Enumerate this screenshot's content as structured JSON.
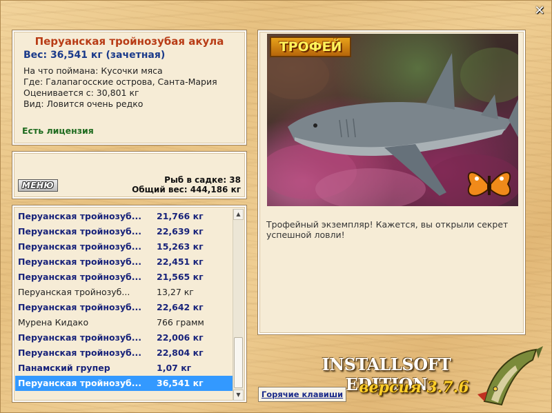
{
  "window": {
    "close_glyph": "✕"
  },
  "fish_info": {
    "title": "Перуанская тройнозубая акула",
    "weight": "Вес: 36,541 кг (зачетная)",
    "details": [
      "На что поймана: Кусочки мяса",
      "Где: Галапагосские острова, Санта-Мария",
      "Оценивается с: 30,801 кг",
      "Вид: Ловится очень редко"
    ],
    "license": "Есть лицензия"
  },
  "stats": {
    "menu_label": "МЕНЮ",
    "fish_in_keepnet": "Рыб в садке: 38",
    "total_weight": "Общий вес: 444,186 кг"
  },
  "catch_list": [
    {
      "name": "Перуанская тройнозуб...",
      "weight": "21,766 кг",
      "style": "bold"
    },
    {
      "name": "Перуанская тройнозуб...",
      "weight": "22,639 кг",
      "style": "bold"
    },
    {
      "name": "Перуанская тройнозуб...",
      "weight": "15,263 кг",
      "style": "bold"
    },
    {
      "name": "Перуанская тройнозуб...",
      "weight": "22,451 кг",
      "style": "bold"
    },
    {
      "name": "Перуанская тройнозуб...",
      "weight": "21,565 кг",
      "style": "bold"
    },
    {
      "name": "Перуанская тройнозуб...",
      "weight": "13,27 кг",
      "style": "plain"
    },
    {
      "name": "Перуанская тройнозуб...",
      "weight": "22,642 кг",
      "style": "bold"
    },
    {
      "name": "Мурена Кидако",
      "weight": "766 грамм",
      "style": "plain"
    },
    {
      "name": "Перуанская тройнозуб...",
      "weight": "22,006 кг",
      "style": "bold"
    },
    {
      "name": "Перуанская тройнозуб...",
      "weight": "22,804 кг",
      "style": "bold"
    },
    {
      "name": "Панамский групер",
      "weight": "1,07 кг",
      "style": "bold"
    },
    {
      "name": "Перуанская тройнозуб...",
      "weight": "36,541 кг",
      "style": "selected"
    }
  ],
  "photo": {
    "badge": "ТРОФЕЙ",
    "description": "Трофейный экземпляр! Кажется, вы открыли секрет успешной ловли!"
  },
  "footer": {
    "hotkeys_label": "Горячие клавиши",
    "brand": "INSTALLSOFT EDITION",
    "version": "версия 3.7.6"
  },
  "icons": {
    "close": "close-icon",
    "scroll_up": "arrow-up-icon",
    "scroll_down": "arrow-down-icon",
    "butterfly": "butterfly-icon",
    "pike": "pike-fish-icon"
  }
}
